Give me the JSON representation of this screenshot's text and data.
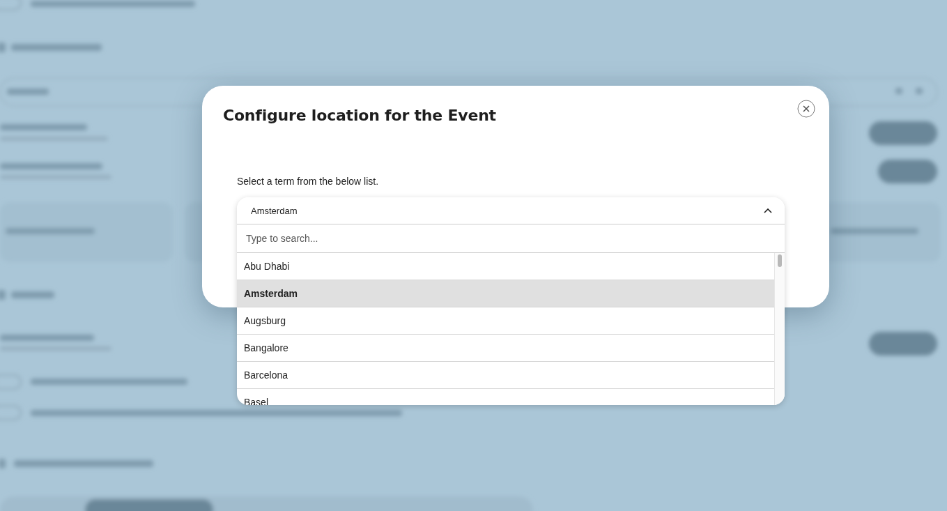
{
  "modal": {
    "title": "Configure location for the Event",
    "prompt": "Select a term from the below list.",
    "dropdown": {
      "value": "Amsterdam",
      "expanded": true,
      "search": {
        "placeholder": "Type to search..."
      },
      "options": [
        {
          "label": "Abu Dhabi",
          "selected": false
        },
        {
          "label": "Amsterdam",
          "selected": true
        },
        {
          "label": "Augsburg",
          "selected": false
        },
        {
          "label": "Bangalore",
          "selected": false
        },
        {
          "label": "Barcelona",
          "selected": false
        },
        {
          "label": "Basel",
          "selected": false
        }
      ]
    }
  }
}
